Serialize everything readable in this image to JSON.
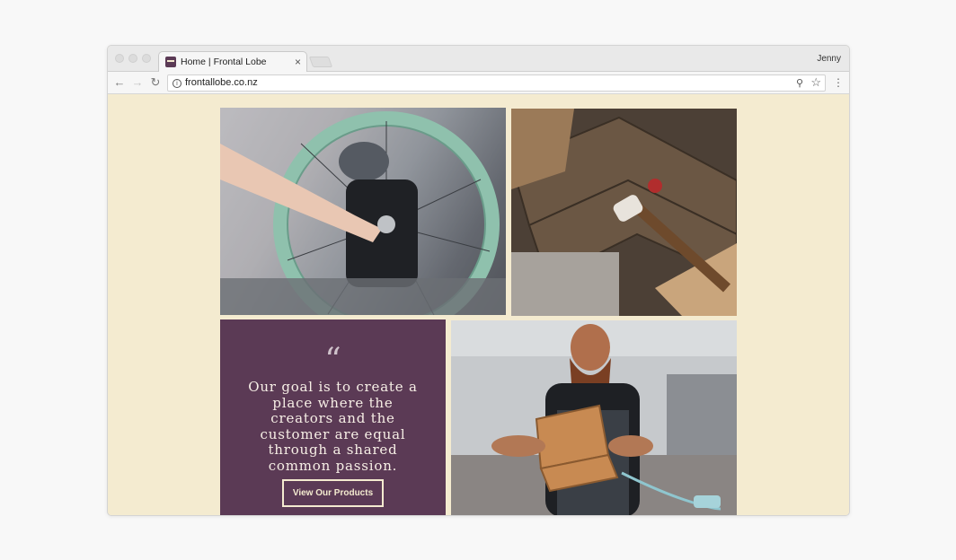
{
  "window": {
    "tab_title": "Home | Frontal Lobe",
    "tab_close_glyph": "×",
    "profile_name": "Jenny"
  },
  "toolbar": {
    "url": "frontallobe.co.nz",
    "back_glyph": "←",
    "forward_glyph": "→",
    "reload_glyph": "↻",
    "info_glyph": "i",
    "zoom_glyph": "⚲",
    "star_glyph": "☆",
    "menu_glyph": "⋮"
  },
  "page": {
    "quote_mark": "“",
    "quote": "Our goal is to create a place where the creators and the customer are equal through a shared common passion.",
    "cta_label": "View Our Products"
  },
  "colors": {
    "page_background": "#f4ebd0",
    "quote_card": "#5b3a55",
    "quote_text": "#f7efe6"
  },
  "icons": [
    "favicon",
    "back-arrow-icon",
    "forward-arrow-icon",
    "reload-icon",
    "info-icon",
    "zoom-icon",
    "star-icon",
    "menu-icon"
  ]
}
